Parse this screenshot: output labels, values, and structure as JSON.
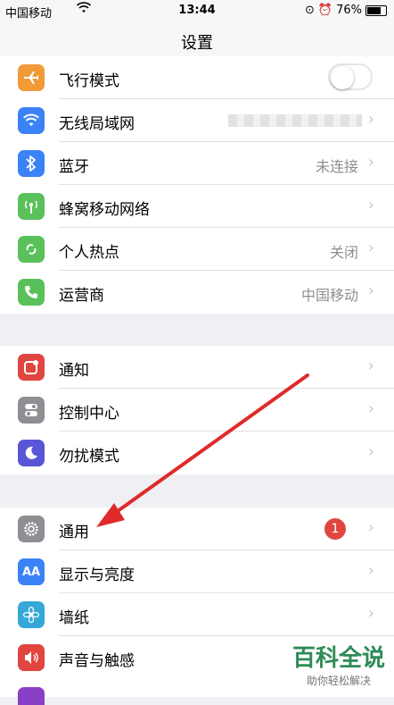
{
  "status_bar": {
    "carrier": "中国移动",
    "time": "13:44",
    "battery": "76%"
  },
  "nav": {
    "title": "设置"
  },
  "group1": [
    {
      "label": "飞行模式",
      "icon": "airplane-icon",
      "color": "#f19a38"
    },
    {
      "label": "无线局域网",
      "icon": "wifi-icon",
      "color": "#3b82f6"
    },
    {
      "label": "蓝牙",
      "value": "未连接",
      "icon": "bluetooth-icon",
      "color": "#3b82f6"
    },
    {
      "label": "蜂窝移动网络",
      "icon": "cellular-icon",
      "color": "#5ac05a"
    },
    {
      "label": "个人热点",
      "value": "关闭",
      "icon": "hotspot-icon",
      "color": "#5ac05a"
    },
    {
      "label": "运营商",
      "value": "中国移动",
      "icon": "phone-icon",
      "color": "#5ac05a"
    }
  ],
  "group2": [
    {
      "label": "通知",
      "icon": "notifications-icon",
      "color": "#e0463f"
    },
    {
      "label": "控制中心",
      "icon": "control-center-icon",
      "color": "#8e8e93"
    },
    {
      "label": "勿扰模式",
      "icon": "moon-icon",
      "color": "#5856d6"
    }
  ],
  "group3": [
    {
      "label": "通用",
      "badge": "1",
      "icon": "gear-icon",
      "color": "#8e8e93"
    },
    {
      "label": "显示与亮度",
      "icon": "text-size-icon",
      "color": "#3b82f6"
    },
    {
      "label": "墙纸",
      "icon": "wallpaper-icon",
      "color": "#35a8d8"
    },
    {
      "label": "声音与触感",
      "icon": "sound-icon",
      "color": "#e0463f"
    }
  ],
  "watermark": {
    "title": "百科全说",
    "subtitle": "助你轻松解决"
  }
}
